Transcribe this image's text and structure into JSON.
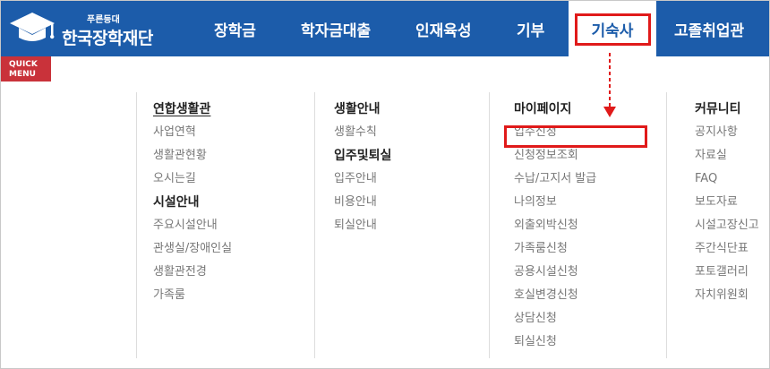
{
  "header": {
    "logo_sub": "푸른등대",
    "logo_main": "한국장학재단",
    "nav": [
      "장학금",
      "학자금대출",
      "인재육성",
      "기부",
      "기숙사",
      "고졸취업관"
    ],
    "active_index": 4
  },
  "quick_menu": {
    "line1": "QUICK",
    "line2": "MENU"
  },
  "menu": {
    "col1": {
      "sections": [
        {
          "heading": "연합생활관",
          "items": [
            "사업연혁",
            "생활관현황",
            "오시는길"
          ]
        },
        {
          "heading": "시설안내",
          "items": [
            "주요시설안내",
            "관생실/장애인실",
            "생활관전경",
            "가족룸"
          ]
        }
      ]
    },
    "col2": {
      "sections": [
        {
          "heading": "생활안내",
          "items": [
            "생활수칙"
          ]
        },
        {
          "heading": "입주및퇴실",
          "items": [
            "입주안내",
            "비용안내",
            "퇴실안내"
          ]
        }
      ]
    },
    "col3": {
      "heading": "마이페이지",
      "items": [
        "입주신청",
        "신청정보조회",
        "수납/고지서 발급",
        "나의정보",
        "외출외박신청",
        "가족룸신청",
        "공용시설신청",
        "호실변경신청",
        "상담신청",
        "퇴실신청"
      ]
    },
    "col4": {
      "heading": "커뮤니티",
      "items": [
        "공지사항",
        "자료실",
        "FAQ",
        "보도자료",
        "시설고장신고",
        "주간식단표",
        "포토갤러리",
        "자치위원회"
      ]
    }
  },
  "colors": {
    "header_bg": "#1c5caa",
    "highlight": "#e01a1a",
    "quick_bg": "#c9323a"
  },
  "icons": [
    "graduation-cap-logo-icon",
    "dashed-arrow-down-icon"
  ]
}
